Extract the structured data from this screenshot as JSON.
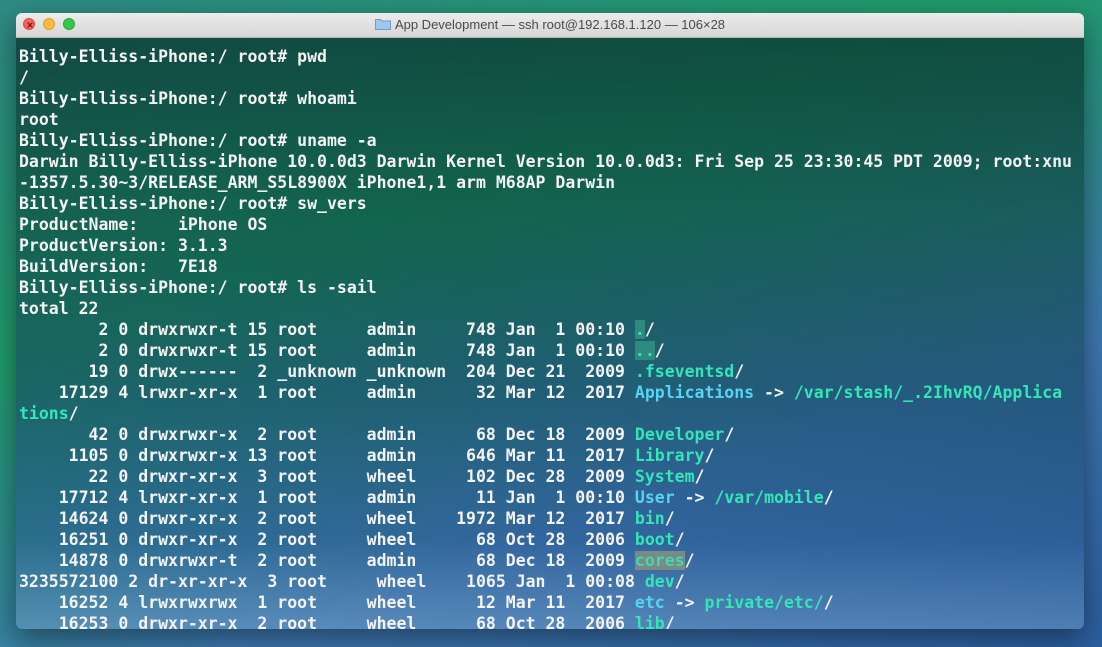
{
  "window": {
    "title": "App Development — ssh root@192.168.1.120 — 106×28"
  },
  "terminal": {
    "lines": [
      {
        "segs": [
          {
            "t": "Billy-Elliss-iPhone:/ root# pwd"
          }
        ]
      },
      {
        "segs": [
          {
            "t": "/"
          }
        ]
      },
      {
        "segs": [
          {
            "t": "Billy-Elliss-iPhone:/ root# whoami"
          }
        ]
      },
      {
        "segs": [
          {
            "t": "root"
          }
        ]
      },
      {
        "segs": [
          {
            "t": "Billy-Elliss-iPhone:/ root# uname -a"
          }
        ]
      },
      {
        "segs": [
          {
            "t": "Darwin Billy-Elliss-iPhone 10.0.0d3 Darwin Kernel Version 10.0.0d3: Fri Sep 25 23:30:45 PDT 2009; root:xnu"
          }
        ]
      },
      {
        "segs": [
          {
            "t": "-1357.5.30~3/RELEASE_ARM_S5L8900X iPhone1,1 arm M68AP Darwin"
          }
        ]
      },
      {
        "segs": [
          {
            "t": "Billy-Elliss-iPhone:/ root# sw_vers"
          }
        ]
      },
      {
        "segs": [
          {
            "t": "ProductName:    iPhone OS"
          }
        ]
      },
      {
        "segs": [
          {
            "t": "ProductVersion: 3.1.3"
          }
        ]
      },
      {
        "segs": [
          {
            "t": "BuildVersion:   7E18"
          }
        ]
      },
      {
        "segs": [
          {
            "t": "Billy-Elliss-iPhone:/ root# ls -sail"
          }
        ]
      },
      {
        "segs": [
          {
            "t": "total 22"
          }
        ]
      },
      {
        "segs": [
          {
            "t": "        2 0 drwxrwxr-t 15 root     admin     748 Jan  1 00:10 "
          },
          {
            "t": ".",
            "c": "c-sel"
          },
          {
            "t": "/"
          }
        ]
      },
      {
        "segs": [
          {
            "t": "        2 0 drwxrwxr-t 15 root     admin     748 Jan  1 00:10 "
          },
          {
            "t": "..",
            "c": "c-sel"
          },
          {
            "t": "/"
          }
        ]
      },
      {
        "segs": [
          {
            "t": "       19 0 drwx------  2 _unknown _unknown  204 Dec 21  2009 "
          },
          {
            "t": ".fseventsd",
            "c": "c-dir"
          },
          {
            "t": "/"
          }
        ]
      },
      {
        "segs": [
          {
            "t": "    17129 4 lrwxr-xr-x  1 root     admin      32 Mar 12  2017 "
          },
          {
            "t": "Applications",
            "c": "c-link"
          },
          {
            "t": " -> "
          },
          {
            "t": "/var/stash/_.2IhvRQ/Applica",
            "c": "c-dir"
          }
        ]
      },
      {
        "segs": [
          {
            "t": "tions",
            "c": "c-dir"
          },
          {
            "t": "/"
          }
        ]
      },
      {
        "segs": [
          {
            "t": "       42 0 drwxrwxr-x  2 root     admin      68 Dec 18  2009 "
          },
          {
            "t": "Developer",
            "c": "c-dir"
          },
          {
            "t": "/"
          }
        ]
      },
      {
        "segs": [
          {
            "t": "     1105 0 drwxrwxr-x 13 root     admin     646 Mar 11  2017 "
          },
          {
            "t": "Library",
            "c": "c-dir"
          },
          {
            "t": "/"
          }
        ]
      },
      {
        "segs": [
          {
            "t": "       22 0 drwxr-xr-x  3 root     wheel     102 Dec 28  2009 "
          },
          {
            "t": "System",
            "c": "c-dir"
          },
          {
            "t": "/"
          }
        ]
      },
      {
        "segs": [
          {
            "t": "    17712 4 lrwxr-xr-x  1 root     admin      11 Jan  1 00:10 "
          },
          {
            "t": "User",
            "c": "c-link"
          },
          {
            "t": " -> "
          },
          {
            "t": "/var/mobile",
            "c": "c-dir"
          },
          {
            "t": "/"
          }
        ]
      },
      {
        "segs": [
          {
            "t": "    14624 0 drwxr-xr-x  2 root     wheel    1972 Mar 12  2017 "
          },
          {
            "t": "bin",
            "c": "c-dir"
          },
          {
            "t": "/"
          }
        ]
      },
      {
        "segs": [
          {
            "t": "    16251 0 drwxr-xr-x  2 root     wheel      68 Oct 28  2006 "
          },
          {
            "t": "boot",
            "c": "c-dir"
          },
          {
            "t": "/"
          }
        ]
      },
      {
        "segs": [
          {
            "t": "    14878 0 drwxrwxr-t  2 root     admin      68 Dec 18  2009 "
          },
          {
            "t": "cores",
            "c": "c-grey"
          },
          {
            "t": "/"
          }
        ]
      },
      {
        "segs": [
          {
            "t": "3235572100 2 dr-xr-xr-x  3 root     wheel    1065 Jan  1 00:08 "
          },
          {
            "t": "dev",
            "c": "c-dir"
          },
          {
            "t": "/"
          }
        ]
      },
      {
        "segs": [
          {
            "t": "    16252 4 lrwxrwxrwx  1 root     wheel      12 Mar 11  2017 "
          },
          {
            "t": "etc",
            "c": "c-link"
          },
          {
            "t": " -> "
          },
          {
            "t": "private/etc/",
            "c": "c-dir"
          },
          {
            "t": "/"
          }
        ]
      },
      {
        "segs": [
          {
            "t": "    16253 0 drwxr-xr-x  2 root     wheel      68 Oct 28  2006 "
          },
          {
            "t": "lib",
            "c": "c-dir"
          },
          {
            "t": "/"
          }
        ]
      }
    ]
  }
}
